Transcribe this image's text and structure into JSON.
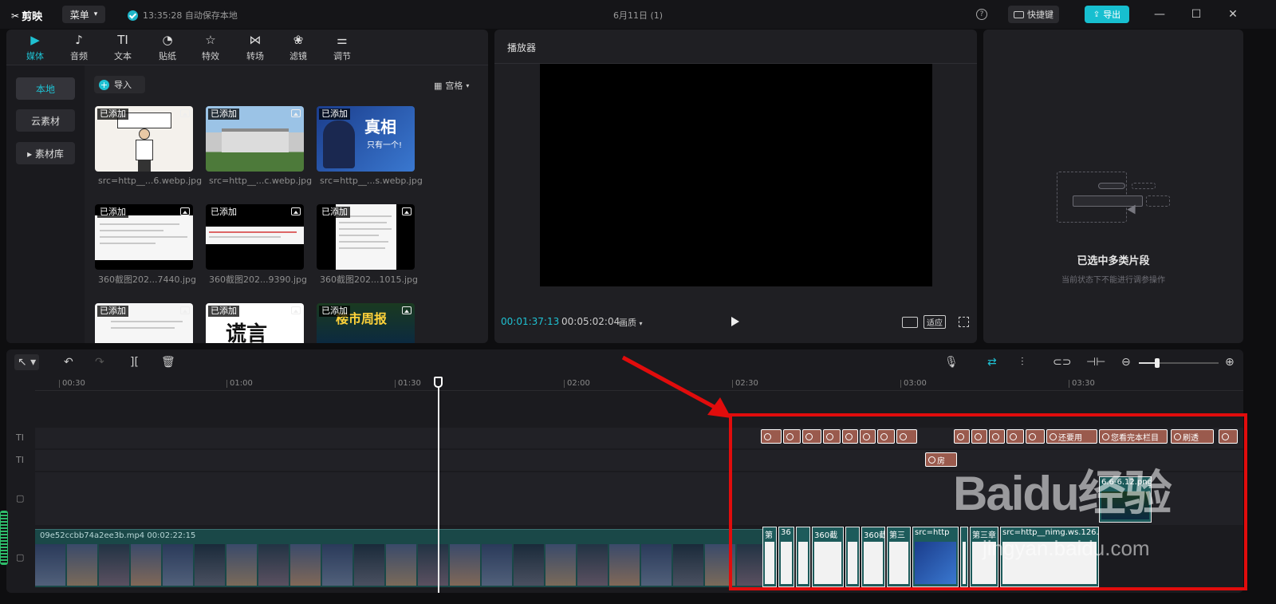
{
  "titlebar": {
    "logo": "剪映",
    "menu_label": "菜单",
    "autosave": "13:35:28 自动保存本地",
    "project_title": "6月11日 (1)",
    "shortcut_label": "快捷键",
    "export_label": "导出",
    "help_symbol": "?",
    "minimize_symbol": "—",
    "maximize_symbol": "☐",
    "close_symbol": "✕"
  },
  "media": {
    "tabs": [
      {
        "label": "媒体",
        "icon": "media-icon",
        "glyph": "▶"
      },
      {
        "label": "音频",
        "icon": "audio-icon",
        "glyph": "♪"
      },
      {
        "label": "文本",
        "icon": "text-icon",
        "glyph": "TI"
      },
      {
        "label": "贴纸",
        "icon": "sticker-icon",
        "glyph": "◔"
      },
      {
        "label": "特效",
        "icon": "effects-icon",
        "glyph": "☆"
      },
      {
        "label": "转场",
        "icon": "transition-icon",
        "glyph": "⋈"
      },
      {
        "label": "滤镜",
        "icon": "filter-icon",
        "glyph": "❀"
      },
      {
        "label": "调节",
        "icon": "adjust-icon",
        "glyph": "⚌"
      }
    ],
    "side": [
      "本地",
      "云素材",
      "▸ 素材库"
    ],
    "import_label": "导入",
    "view_label": "宫格",
    "added_badge": "已添加",
    "files": [
      "src=http__...6.webp.jpg",
      "src=http__...c.webp.jpg",
      "src=http__...s.webp.jpg",
      "360截图202...7440.jpg",
      "360截图202...9390.jpg",
      "360截图202...1015.jpg"
    ],
    "thumb_text": {
      "conan_big": "真相",
      "conan_small": "只有一个!",
      "row3_b": "谎言",
      "row3_c": "楼市周报"
    }
  },
  "player": {
    "title": "播放器",
    "current_time": "00:01:37:13",
    "total_time": "00:05:02:04",
    "quality_label": "画质",
    "fit_label": "适应"
  },
  "props": {
    "title": "已选中多类片段",
    "subtitle": "当前状态下不能进行调参操作"
  },
  "timeline": {
    "ruler": [
      "00:30",
      "01:00",
      "01:30",
      "02:00",
      "02:30",
      "03:00",
      "03:30"
    ],
    "text_clips_row1": [
      "",
      "",
      "",
      "",
      "",
      "",
      "",
      "",
      "",
      "",
      "",
      "",
      "",
      "还要用",
      "您看完本栏目",
      "刷透",
      ""
    ],
    "text_clips_row2": [
      "房"
    ],
    "main_video_label": "09e52ccbb74a2ee3b.mp4   00:02:22:15",
    "image_clips": [
      "第",
      "36",
      "360截",
      "",
      "360截",
      "第三",
      "src=http",
      "",
      "第三章",
      "src=http__nimg.ws.126."
    ],
    "overlay_clip": "6.6-6.12.png"
  },
  "watermark": {
    "main": "Baidu经验",
    "sub": "jingyan.baidu.com"
  },
  "colors": {
    "accent": "#1fc1d2",
    "text_clip": "#9a5a4d",
    "video_track": "#1a4848",
    "highlight": "#e10c0c"
  }
}
